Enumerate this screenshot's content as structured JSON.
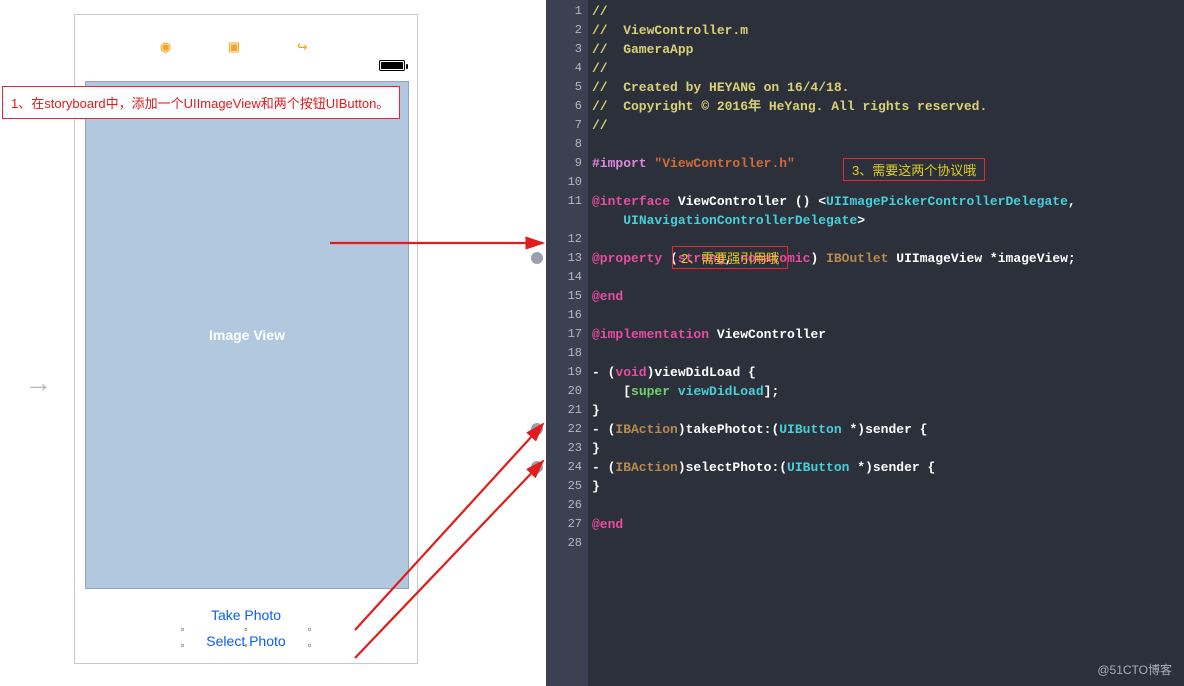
{
  "left": {
    "title_icons": "◉ ▣ ↪",
    "image_view_label": "Image View",
    "take_photo": "Take Photo",
    "select_photo": "Select Photo",
    "note1": "1、在storyboard中，添加一个UIImageView和两个按钮UIButton。"
  },
  "annotations": {
    "a2": "2、需要强引用哦",
    "a3": "3、需要这两个协议哦"
  },
  "watermark": "@51CTO博客",
  "code_lines": [
    {
      "n": 1,
      "frag": [
        {
          "c": "c-comment",
          "t": "//"
        }
      ]
    },
    {
      "n": 2,
      "frag": [
        {
          "c": "c-comment",
          "t": "//  ViewController.m"
        }
      ]
    },
    {
      "n": 3,
      "frag": [
        {
          "c": "c-comment",
          "t": "//  GameraApp"
        }
      ]
    },
    {
      "n": 4,
      "frag": [
        {
          "c": "c-comment",
          "t": "//"
        }
      ]
    },
    {
      "n": 5,
      "frag": [
        {
          "c": "c-comment",
          "t": "//  Created by HEYANG on 16/4/18."
        }
      ]
    },
    {
      "n": 6,
      "frag": [
        {
          "c": "c-comment",
          "t": "//  Copyright © 2016年 HeYang. All rights reserved."
        }
      ]
    },
    {
      "n": 7,
      "frag": [
        {
          "c": "c-comment",
          "t": "//"
        }
      ]
    },
    {
      "n": 8,
      "frag": []
    },
    {
      "n": 9,
      "frag": [
        {
          "c": "c-dir",
          "t": "#import "
        },
        {
          "c": "c-string",
          "t": "\"ViewController.h\""
        }
      ]
    },
    {
      "n": 10,
      "frag": []
    },
    {
      "n": 11,
      "frag": [
        {
          "c": "c-keyword",
          "t": "@interface"
        },
        {
          "c": "c-name",
          "t": " ViewController () <"
        },
        {
          "c": "c-type",
          "t": "UIImagePickerControllerDelegate"
        },
        {
          "c": "c-name",
          "t": ","
        }
      ]
    },
    {
      "n": -1,
      "frag": [
        {
          "c": "c-name",
          "t": "    "
        },
        {
          "c": "c-type",
          "t": "UINavigationControllerDelegate"
        },
        {
          "c": "c-name",
          "t": ">"
        }
      ]
    },
    {
      "n": 12,
      "frag": []
    },
    {
      "n": 13,
      "cxn": "filled",
      "frag": [
        {
          "c": "c-keyword",
          "t": "@property"
        },
        {
          "c": "c-name",
          "t": " ("
        },
        {
          "c": "c-keyword",
          "t": "strong"
        },
        {
          "c": "c-name",
          "t": ", "
        },
        {
          "c": "c-keyword",
          "t": "nonatomic"
        },
        {
          "c": "c-name",
          "t": ") "
        },
        {
          "c": "c-ib",
          "t": "IBOutlet"
        },
        {
          "c": "c-name",
          "t": " UIImageView *imageView;"
        }
      ]
    },
    {
      "n": 14,
      "frag": []
    },
    {
      "n": 15,
      "frag": [
        {
          "c": "c-keyword",
          "t": "@end"
        }
      ]
    },
    {
      "n": 16,
      "frag": []
    },
    {
      "n": 17,
      "frag": [
        {
          "c": "c-keyword",
          "t": "@implementation"
        },
        {
          "c": "c-name",
          "t": " ViewController"
        }
      ]
    },
    {
      "n": 18,
      "frag": []
    },
    {
      "n": 19,
      "frag": [
        {
          "c": "c-name",
          "t": "- ("
        },
        {
          "c": "c-keyword",
          "t": "void"
        },
        {
          "c": "c-name",
          "t": ")viewDidLoad {"
        }
      ]
    },
    {
      "n": 20,
      "frag": [
        {
          "c": "c-name",
          "t": "    ["
        },
        {
          "c": "c-super",
          "t": "super"
        },
        {
          "c": "c-name",
          "t": " "
        },
        {
          "c": "c-type",
          "t": "viewDidLoad"
        },
        {
          "c": "c-name",
          "t": "];"
        }
      ]
    },
    {
      "n": 21,
      "frag": [
        {
          "c": "c-name",
          "t": "}"
        }
      ]
    },
    {
      "n": 22,
      "cxn": "filled",
      "frag": [
        {
          "c": "c-name",
          "t": "- ("
        },
        {
          "c": "c-ib",
          "t": "IBAction"
        },
        {
          "c": "c-name",
          "t": ")takePhotot:("
        },
        {
          "c": "c-type",
          "t": "UIButton"
        },
        {
          "c": "c-name",
          "t": " *)sender {"
        }
      ]
    },
    {
      "n": 23,
      "frag": [
        {
          "c": "c-name",
          "t": "}"
        }
      ]
    },
    {
      "n": 24,
      "cxn": "filled",
      "frag": [
        {
          "c": "c-name",
          "t": "- ("
        },
        {
          "c": "c-ib",
          "t": "IBAction"
        },
        {
          "c": "c-name",
          "t": ")selectPhoto:("
        },
        {
          "c": "c-type",
          "t": "UIButton"
        },
        {
          "c": "c-name",
          "t": " *)sender {"
        }
      ]
    },
    {
      "n": 25,
      "frag": [
        {
          "c": "c-name",
          "t": "}"
        }
      ]
    },
    {
      "n": 26,
      "frag": []
    },
    {
      "n": 27,
      "frag": [
        {
          "c": "c-keyword",
          "t": "@end"
        }
      ]
    },
    {
      "n": 28,
      "frag": []
    }
  ]
}
